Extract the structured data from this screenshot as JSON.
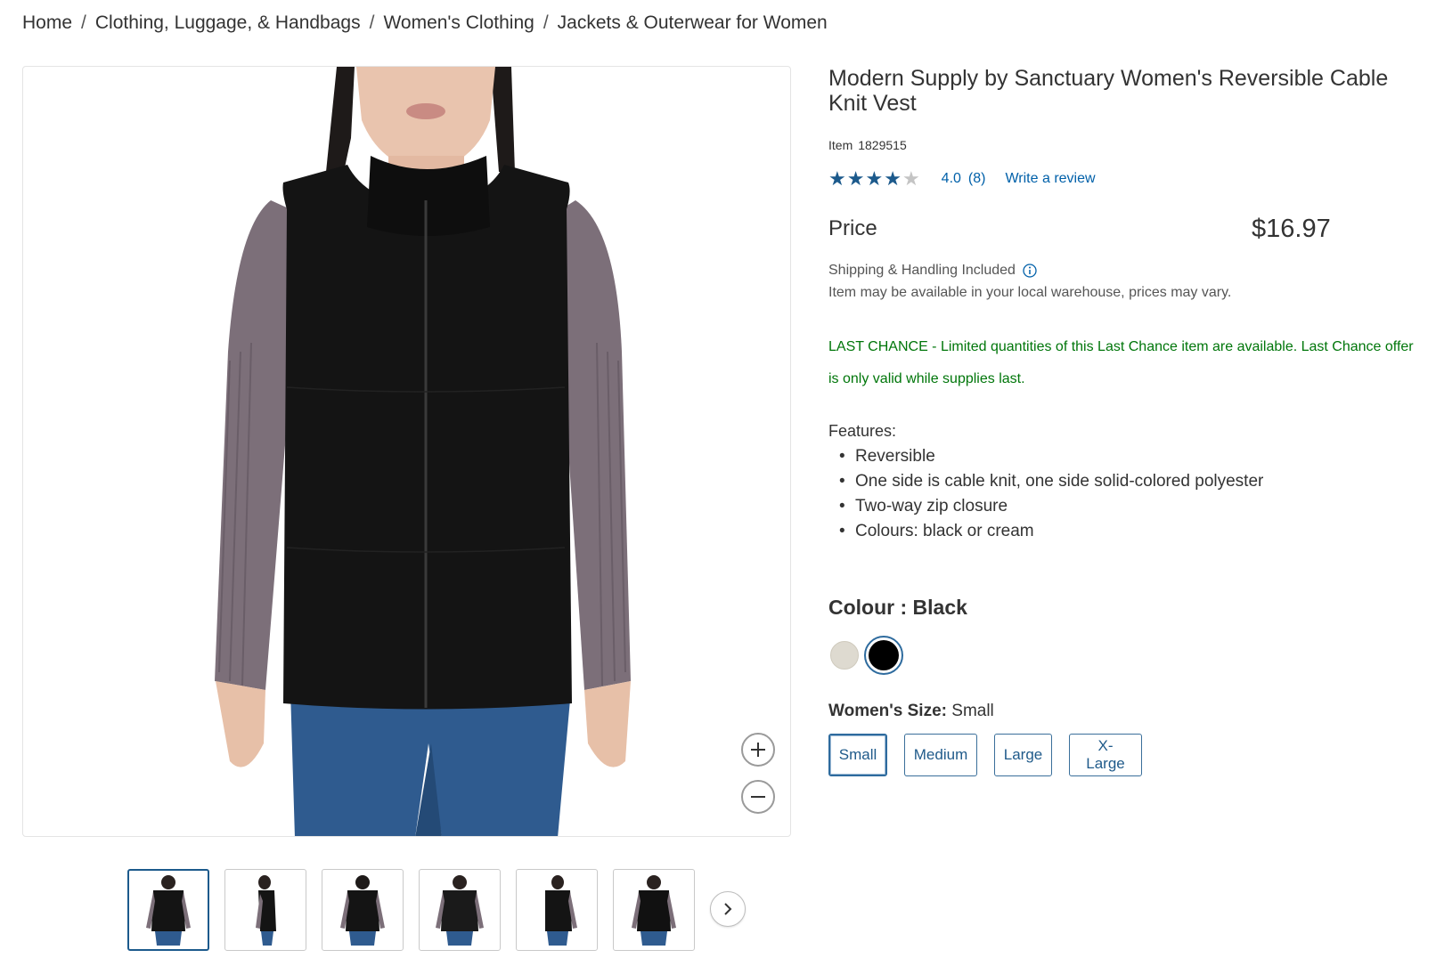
{
  "breadcrumb": {
    "items": [
      "Home",
      "Clothing, Luggage, & Handbags",
      "Women's Clothing",
      "Jackets & Outerwear for Women"
    ],
    "separator": "/"
  },
  "gallery": {
    "thumbnail_count": 6,
    "active_thumbnail": 1
  },
  "product": {
    "title": "Modern Supply by Sanctuary Women's Reversible Cable Knit Vest",
    "item_label": "Item",
    "item_number": "1829515",
    "rating": {
      "value": "4.0",
      "count": "(8)",
      "stars_filled": 4,
      "stars_total": 5,
      "write_review": "Write a review"
    },
    "price_label": "Price",
    "price": "$16.97",
    "shipping": "Shipping & Handling Included",
    "warehouse_note": "Item may be available in your local warehouse, prices may vary.",
    "last_chance": "LAST CHANCE - Limited quantities of this Last Chance item are available. Last Chance offer is only valid while supplies last.",
    "features_title": "Features:",
    "features": [
      "Reversible",
      "One side is cable knit, one side solid-colored polyester",
      "Two-way zip closure",
      "Colours: black or cream"
    ],
    "colour": {
      "label": "Colour :",
      "selected": "Black",
      "options": [
        {
          "name": "cream",
          "hex": "#dedad0"
        },
        {
          "name": "black",
          "hex": "#000000"
        }
      ]
    },
    "size": {
      "label": "Women's Size:",
      "selected": "Small",
      "options": [
        "Small",
        "Medium",
        "Large",
        "X-Large"
      ]
    }
  },
  "colors": {
    "link": "#0060a9",
    "accent": "#1f5a8a",
    "star": "#1c5a8c",
    "star_empty": "#c4c4c4",
    "last_chance": "#00760a"
  },
  "icons": {
    "zoom_in": "plus-icon",
    "zoom_out": "minus-icon",
    "next": "chevron-right-icon",
    "info": "info-icon"
  }
}
